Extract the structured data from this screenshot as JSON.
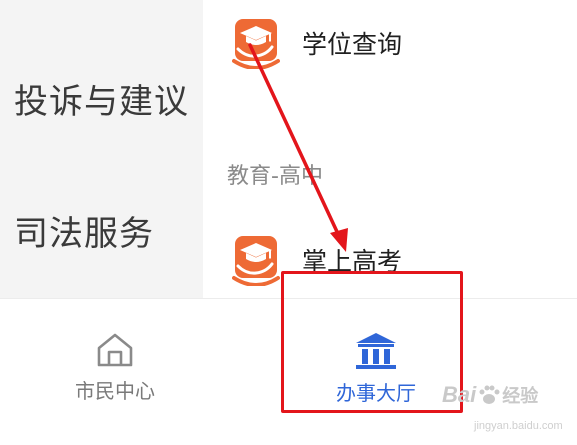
{
  "categories": {
    "complaint": "投诉与建议",
    "judicial": "司法服务"
  },
  "services": {
    "degree_query": "学位查询",
    "section_title": "教育-高中",
    "gaokao": "掌上高考"
  },
  "tabs": {
    "citizen_center": "市民中心",
    "service_hall": "办事大厅",
    "active": "service_hall"
  },
  "watermark": {
    "brand": "Bai",
    "brand2": "经验",
    "url": "jingyan.baidu.com"
  },
  "colors": {
    "accent_blue": "#2f66d8",
    "icon_orange": "#ee6a35",
    "annotation_red": "#e3151b",
    "inactive_gray": "#7a7a7a"
  },
  "icons": {
    "degree_query": "graduation-cap-hand-icon",
    "gaokao": "graduation-cap-hand-icon",
    "citizen_center": "house-icon",
    "service_hall": "government-building-icon"
  }
}
